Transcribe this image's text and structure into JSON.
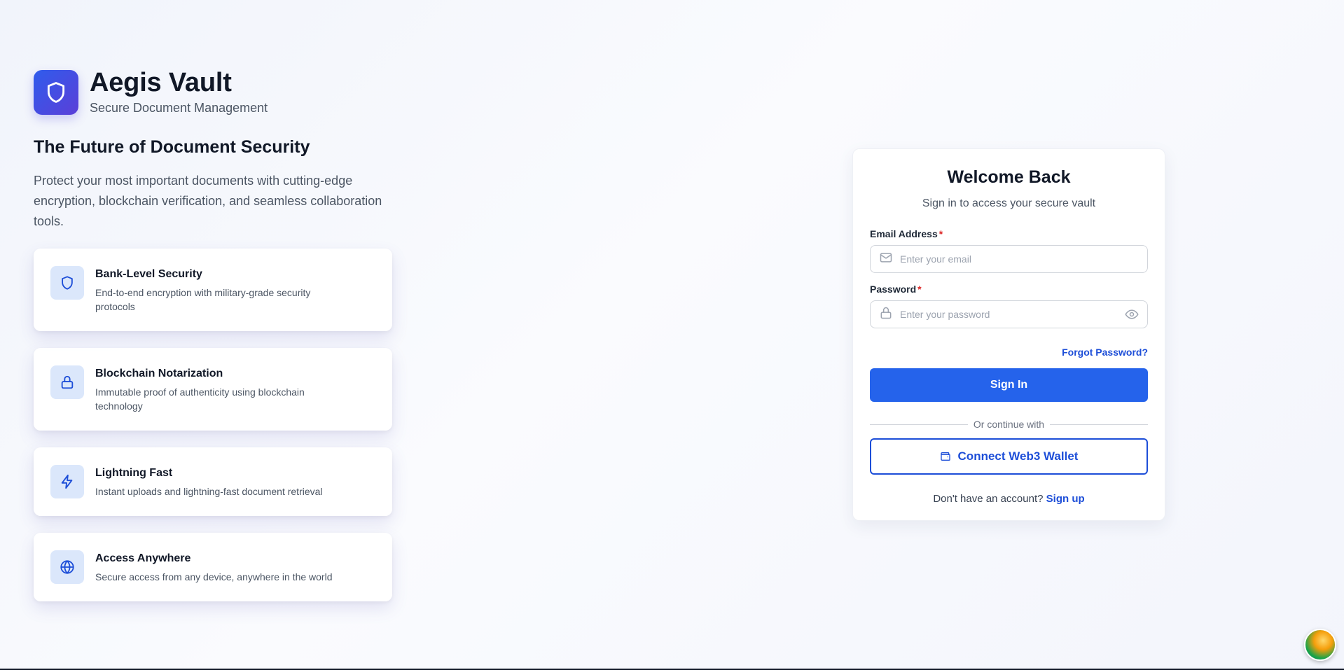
{
  "brand": {
    "title": "Aegis Vault",
    "subtitle": "Secure Document Management",
    "logo_icon": "shield-icon"
  },
  "hero": {
    "heading": "The Future of Document Security",
    "description": "Protect your most important documents with cutting-edge encryption, blockchain verification, and seamless collaboration tools."
  },
  "features": [
    {
      "icon": "shield-icon",
      "title": "Bank-Level Security",
      "description": "End-to-end encryption with military-grade security protocols"
    },
    {
      "icon": "lock-icon",
      "title": "Blockchain Notarization",
      "description": "Immutable proof of authenticity using blockchain technology"
    },
    {
      "icon": "lightning-icon",
      "title": "Lightning Fast",
      "description": "Instant uploads and lightning-fast document retrieval"
    },
    {
      "icon": "globe-icon",
      "title": "Access Anywhere",
      "description": "Secure access from any device, anywhere in the world"
    }
  ],
  "login": {
    "title": "Welcome Back",
    "subtitle": "Sign in to access your secure vault",
    "email_label": "Email Address",
    "email_placeholder": "Enter your email",
    "email_value": "",
    "password_label": "Password",
    "password_placeholder": "Enter your password",
    "password_value": "",
    "required_mark": "*",
    "forgot_link": "Forgot Password?",
    "signin_button": "Sign In",
    "divider_text": "Or continue with",
    "wallet_button": "Connect Web3 Wallet",
    "signup_prompt": "Don't have an account?",
    "signup_link": "Sign up"
  },
  "colors": {
    "primary": "#2563eb",
    "link": "#1d4ed8",
    "required": "#dc2626",
    "icon_tile": "#dbe7fb"
  }
}
